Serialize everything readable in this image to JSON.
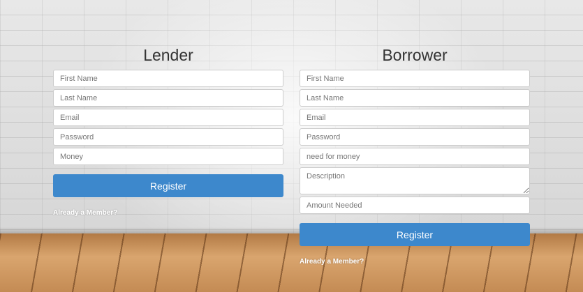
{
  "lender": {
    "title": "Lender",
    "fields": {
      "first_name": "First Name",
      "last_name": "Last Name",
      "email": "Email",
      "password": "Password",
      "money": "Money"
    },
    "register_label": "Register",
    "member_link": "Already a Member?"
  },
  "borrower": {
    "title": "Borrower",
    "fields": {
      "first_name": "First Name",
      "last_name": "Last Name",
      "email": "Email",
      "password": "Password",
      "need": "need for money",
      "description": "Description",
      "amount": "Amount Needed"
    },
    "register_label": "Register",
    "member_link": "Already a Member?"
  },
  "colors": {
    "button": "#3d88cc",
    "title_text": "#333333"
  }
}
